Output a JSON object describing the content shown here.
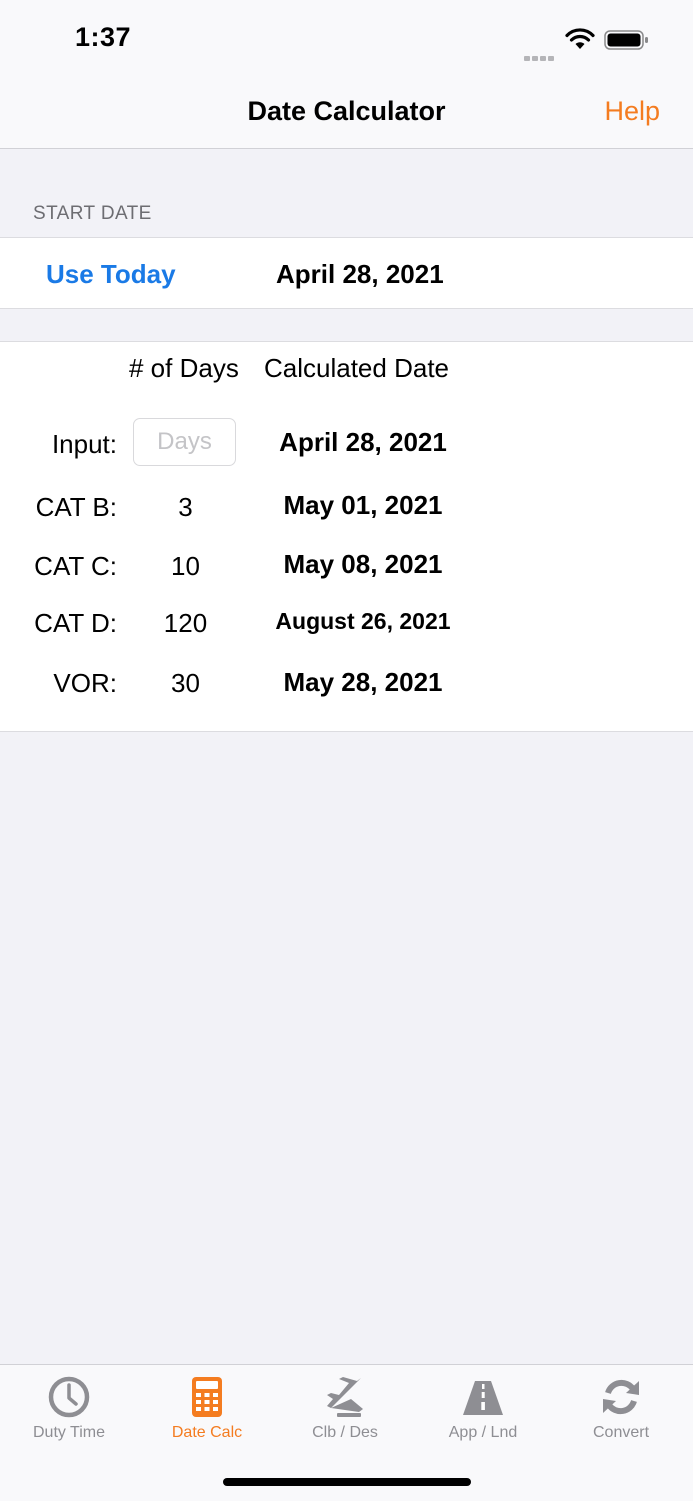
{
  "status": {
    "time": "1:37"
  },
  "nav": {
    "title": "Date Calculator",
    "help": "Help"
  },
  "start": {
    "header": "START DATE",
    "use_today": "Use Today",
    "date": "April 28, 2021"
  },
  "calc": {
    "col_days": "# of Days",
    "col_date": "Calculated Date",
    "input": {
      "label": "Input:",
      "placeholder": "Days",
      "value": "",
      "date": "April 28, 2021"
    },
    "rows": [
      {
        "label": "CAT B:",
        "days": "3",
        "date": "May 01, 2021"
      },
      {
        "label": "CAT C:",
        "days": "10",
        "date": "May 08, 2021"
      },
      {
        "label": "CAT D:",
        "days": "120",
        "date": "August 26, 2021"
      },
      {
        "label": "VOR:",
        "days": "30",
        "date": "May 28, 2021"
      }
    ]
  },
  "tabs": [
    {
      "label": "Duty Time",
      "icon": "clock-icon"
    },
    {
      "label": "Date Calc",
      "icon": "calculator-icon",
      "active": true
    },
    {
      "label": "Clb / Des",
      "icon": "airplane-icon"
    },
    {
      "label": "App / Lnd",
      "icon": "runway-icon"
    },
    {
      "label": "Convert",
      "icon": "refresh-icon"
    }
  ],
  "colors": {
    "accent": "#f47c20",
    "link": "#1a7ae6",
    "inactive": "#8e8e93",
    "background": "#f2f2f7"
  }
}
